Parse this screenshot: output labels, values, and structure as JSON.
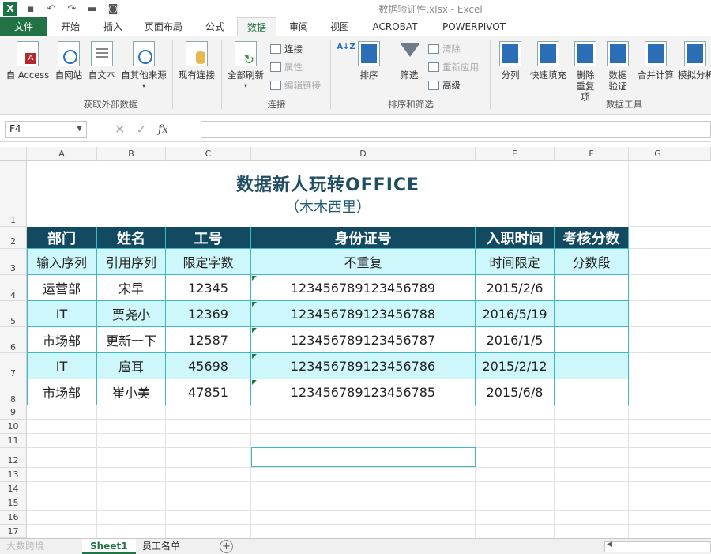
{
  "title_bar": {
    "filename": "数据验证性.xlsx - Excel",
    "app_icon": "X"
  },
  "quick_access": {
    "icons": [
      "save-icon",
      "undo-icon",
      "redo-icon",
      "folder-icon",
      "camera-icon"
    ]
  },
  "tabs": [
    "文件",
    "开始",
    "插入",
    "页面布局",
    "公式",
    "数据",
    "审阅",
    "视图",
    "ACROBAT",
    "POWERPIVOT"
  ],
  "active_tab": "数据",
  "ribbon": {
    "groups": {
      "external": {
        "label": "获取外部数据",
        "buttons": [
          "自 Access",
          "自网站",
          "自文本",
          "自其他来源",
          "现有连接"
        ]
      },
      "connections": {
        "label": "连接",
        "refresh_all": "全部刷新",
        "connect": "连接",
        "properties": "属性",
        "edit_links": "编辑链接"
      },
      "sort_filter": {
        "label": "排序和筛选",
        "sort": "排序",
        "filter": "筛选",
        "clear": "清除",
        "reapply": "重新应用",
        "advanced": "高级"
      },
      "data_tools": {
        "label": "数据工具",
        "buttons": [
          "分列",
          "快速填充",
          "删除重复项",
          "数据验证",
          "合并计算",
          "模拟分析"
        ]
      }
    }
  },
  "formula_bar": {
    "name_box": "F4",
    "cancel": "✕",
    "enter": "✓",
    "fx": "fx",
    "formula": ""
  },
  "columns": [
    "A",
    "B",
    "C",
    "D",
    "E",
    "F",
    "G"
  ],
  "rows": [
    "1",
    "2",
    "3",
    "4",
    "5",
    "6",
    "7",
    "8",
    "9",
    "10",
    "11",
    "12",
    "13",
    "14",
    "15",
    "16",
    "17"
  ],
  "sheet": {
    "title": "数据新人玩转OFFICE",
    "subtitle": "（木木西里）",
    "headers": [
      "部门",
      "姓名",
      "工号",
      "身份证号",
      "入职时间",
      "考核分数"
    ],
    "rules": [
      "输入序列",
      "引用序列",
      "限定字数",
      "不重复",
      "时间限定",
      "分数段"
    ],
    "records": [
      [
        "运营部",
        "宋早",
        "12345",
        "123456789123456789",
        "2015/2/6",
        ""
      ],
      [
        "IT",
        "贾尧小",
        "12369",
        "123456789123456788",
        "2016/5/19",
        ""
      ],
      [
        "市场部",
        "更新一下",
        "12587",
        "123456789123456787",
        "2016/1/5",
        ""
      ],
      [
        "IT",
        "扈耳",
        "45698",
        "123456789123456786",
        "2015/2/12",
        ""
      ],
      [
        "市场部",
        "崔小美",
        "47851",
        "123456789123456785",
        "2015/6/8",
        ""
      ]
    ]
  },
  "sheet_tabs": [
    "Sheet1",
    "员工名单"
  ],
  "watermark": "大数跨境",
  "colors": {
    "excel_green": "#217346",
    "header_fill": "#114a61",
    "band_fill": "#cdf7fa",
    "border": "#3fb8c2",
    "title_color": "#1f4e63"
  }
}
